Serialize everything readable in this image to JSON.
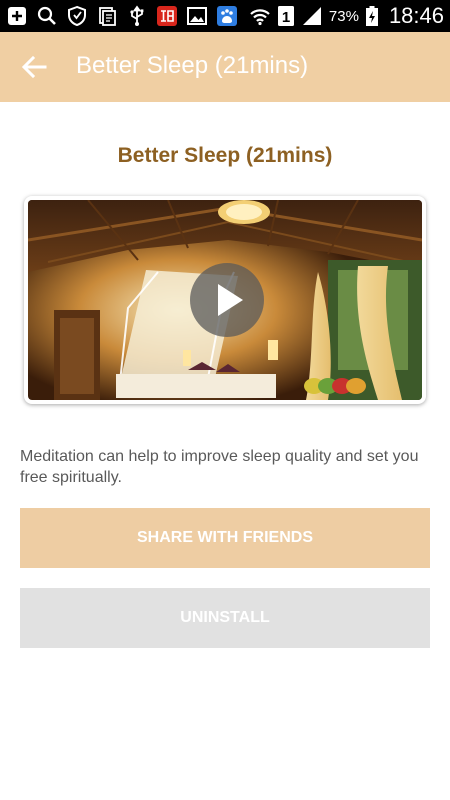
{
  "status_bar": {
    "icons": [
      "add-box-icon",
      "search-icon",
      "shield-icon",
      "document-icon",
      "usb-icon",
      "news-app-icon",
      "image-icon",
      "baidu-icon",
      "wifi-icon",
      "sim-1-icon",
      "signal-icon",
      "battery-charging-icon"
    ],
    "sim_label": "1",
    "battery": "73%",
    "time": "18:46"
  },
  "app_bar": {
    "back_icon": "arrow-left-icon",
    "title": "Better Sleep (21mins)",
    "background": "#f0cfa3"
  },
  "content": {
    "title": "Better Sleep (21mins)",
    "video": {
      "thumbnail": "bedroom-canopy-bed-image",
      "play_icon": "play-icon"
    },
    "description": "Meditation can help to improve sleep quality and set you free spiritually."
  },
  "buttons": {
    "share_label": "SHARE WITH FRIENDS",
    "uninstall_label": "UNINSTALL"
  },
  "colors": {
    "accent": "#f0cfa3",
    "title_text": "#8d6022",
    "share_button": "#eecda3",
    "uninstall_button": "#e1e1e1"
  }
}
